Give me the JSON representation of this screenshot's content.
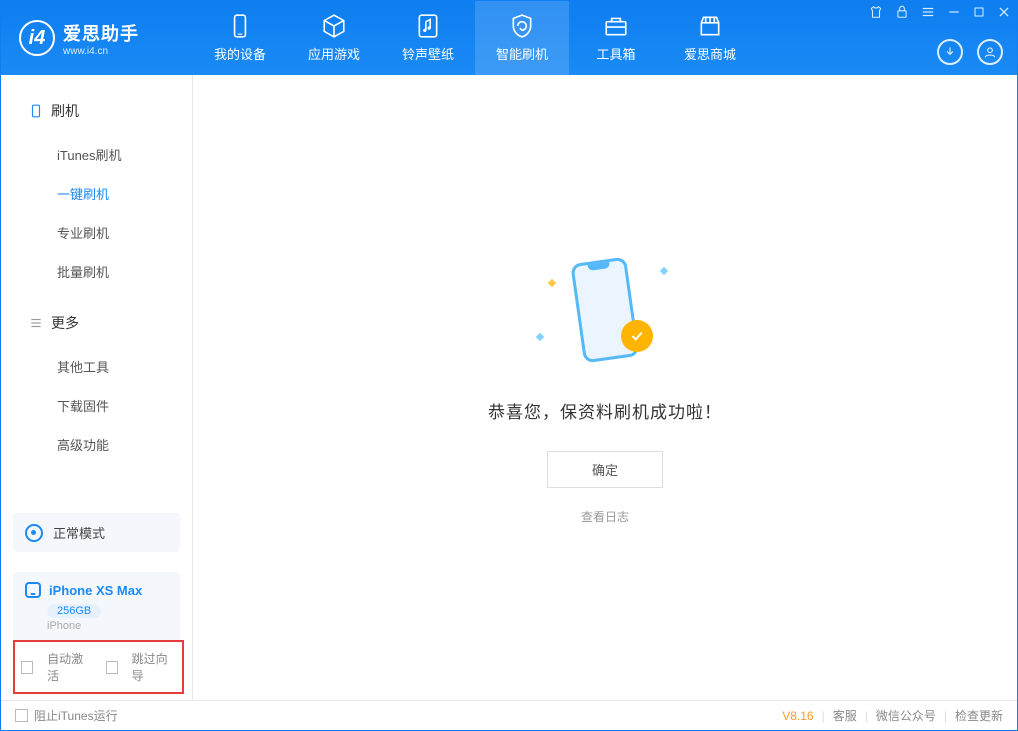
{
  "app": {
    "name": "爱思助手",
    "url": "www.i4.cn"
  },
  "tabs": [
    {
      "id": "device",
      "label": "我的设备"
    },
    {
      "id": "apps",
      "label": "应用游戏"
    },
    {
      "id": "ring",
      "label": "铃声壁纸"
    },
    {
      "id": "flash",
      "label": "智能刷机",
      "active": true
    },
    {
      "id": "tools",
      "label": "工具箱"
    },
    {
      "id": "store",
      "label": "爱思商城"
    }
  ],
  "sidebar": {
    "group1": {
      "title": "刷机",
      "items": [
        "iTunes刷机",
        "一键刷机",
        "专业刷机",
        "批量刷机"
      ],
      "activeIndex": 1
    },
    "group2": {
      "title": "更多",
      "items": [
        "其他工具",
        "下载固件",
        "高级功能"
      ]
    }
  },
  "mode": {
    "label": "正常模式"
  },
  "device": {
    "name": "iPhone XS Max",
    "capacity": "256GB",
    "type": "iPhone"
  },
  "options": {
    "opt1": "自动激活",
    "opt2": "跳过向导"
  },
  "main": {
    "success": "恭喜您，保资料刷机成功啦！",
    "confirm": "确定",
    "viewLog": "查看日志"
  },
  "footer": {
    "blockItunes": "阻止iTunes运行",
    "version": "V8.16",
    "links": [
      "客服",
      "微信公众号",
      "检查更新"
    ]
  }
}
